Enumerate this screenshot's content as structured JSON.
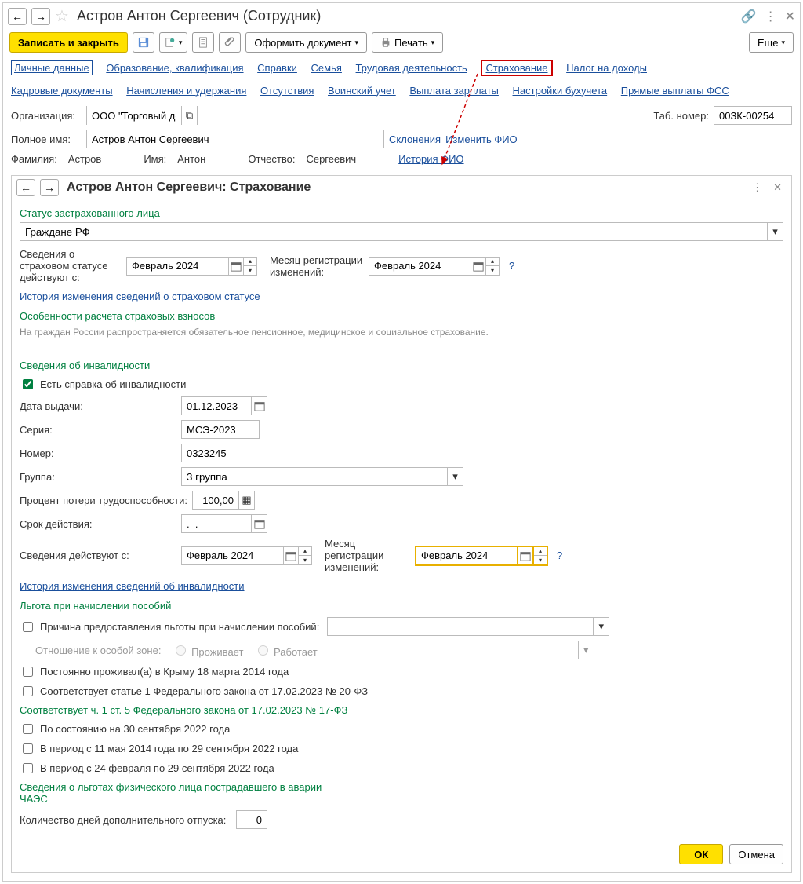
{
  "main": {
    "title": "Астров Антон Сергеевич (Сотрудник)",
    "save_close": "Записать и закрыть",
    "doc_btn": "Оформить документ",
    "print_btn": "Печать",
    "more_btn": "Еще"
  },
  "tabs1": {
    "personal": "Личные данные",
    "education": "Образование, квалификация",
    "references": "Справки",
    "family": "Семья",
    "work": "Трудовая деятельность",
    "insurance": "Страхование",
    "tax": "Налог на доходы"
  },
  "tabs2": {
    "hr_docs": "Кадровые документы",
    "accruals": "Начисления и удержания",
    "absences": "Отсутствия",
    "military": "Воинский учет",
    "salary": "Выплата зарплаты",
    "accounting": "Настройки бухучета",
    "fss": "Прямые выплаты ФСС"
  },
  "emp": {
    "org_label": "Организация:",
    "org_value": "ООО \"Торговый дом\"",
    "tab_no_label": "Таб. номер:",
    "tab_no_value": "00ЗК-00254",
    "fullname_label": "Полное имя:",
    "fullname_value": "Астров Антон Сергеевич",
    "declensions": "Склонения",
    "change_fio": "Изменить ФИО",
    "surname_label": "Фамилия:",
    "surname_value": "Астров",
    "name_label": "Имя:",
    "name_value": "Антон",
    "patr_label": "Отчество:",
    "patr_value": "Сергеевич",
    "fio_history": "История ФИО"
  },
  "sub": {
    "title": "Астров Антон Сергеевич: Страхование",
    "status_section": "Статус застрахованного лица",
    "status_value": "Граждане РФ",
    "info_valid_from": "Сведения о страховом статусе действуют с:",
    "month1": "Февраль 2024",
    "reg_month_label": "Месяц регистрации изменений:",
    "month2": "Февраль 2024",
    "history_link1": "История изменения сведений о страховом статусе",
    "features_title": "Особенности расчета страховых взносов",
    "features_hint": "На граждан России распространяется обязательное пенсионное, медицинское и социальное страхование.",
    "disability_section": "Сведения об инвалидности",
    "has_cert": "Есть справка об инвалидности",
    "issue_date_label": "Дата выдачи:",
    "issue_date": "01.12.2023",
    "series_label": "Серия:",
    "series": "МСЭ-2023",
    "number_label": "Номер:",
    "number": "0323245",
    "group_label": "Группа:",
    "group": "3 группа",
    "percent_label": "Процент потери трудоспособности:",
    "percent": "100,00",
    "validity_label": "Срок действия:",
    "validity": ".  .",
    "info_from_label": "Сведения действуют с:",
    "info_from": "Февраль 2024",
    "reg_month2": "Февраль 2024",
    "history_link2": "История изменения сведений об инвалидности",
    "benefit_section": "Льгота при начислении пособий",
    "benefit_reason": "Причина предоставления льготы при начислении пособий:",
    "zone_label": "Отношение к особой зоне:",
    "radio_lives": "Проживает",
    "radio_works": "Работает",
    "crimea": "Постоянно проживал(а) в Крыму 18 марта 2014 года",
    "art1": "Соответствует статье 1 Федерального закона от 17.02.2023 № 20-ФЗ",
    "art5_title": "Соответствует ч. 1 ст. 5 Федерального закона от 17.02.2023 № 17-ФЗ",
    "opt1": "По состоянию на 30 сентября 2022 года",
    "opt2": "В период с 11 мая 2014 года по 29 сентября 2022 года",
    "opt3": "В период с 24 февраля по 29 сентября 2022 года",
    "chaes_title": "Сведения о льготах физического лица пострадавшего в аварии ЧАЭС",
    "extra_days_label": "Количество дней дополнительного отпуска:",
    "extra_days": "0",
    "ok": "ОК",
    "cancel": "Отмена"
  }
}
